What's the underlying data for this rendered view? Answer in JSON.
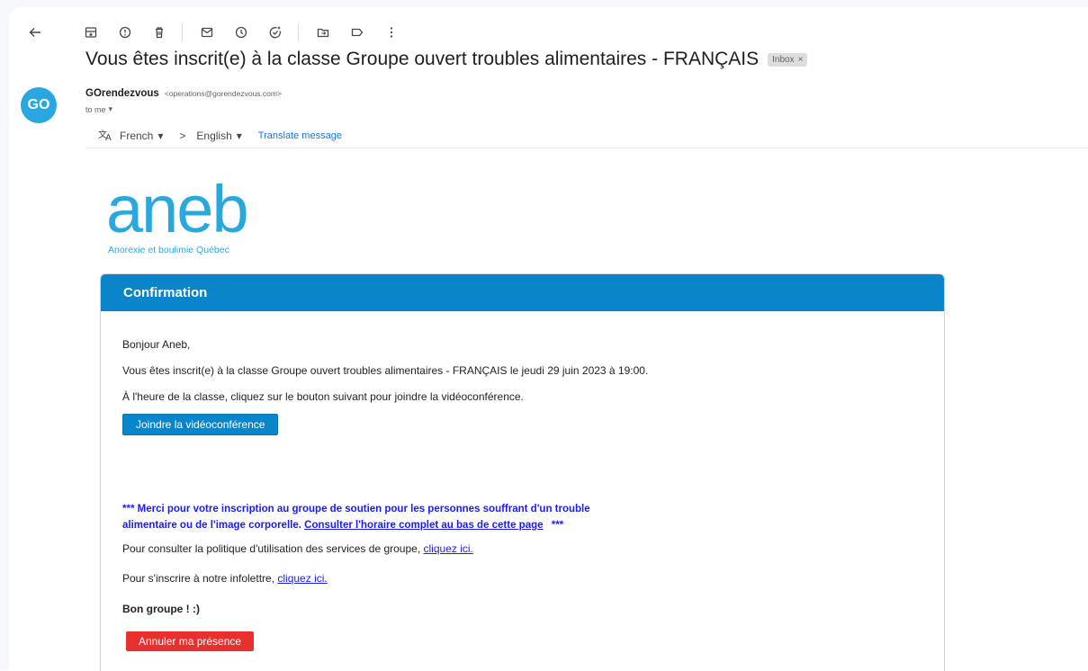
{
  "toolbar": {
    "icons": [
      "back-arrow-icon",
      "archive-icon",
      "report-spam-icon",
      "delete-icon",
      "mark-unread-icon",
      "snooze-icon",
      "add-task-icon",
      "move-to-icon",
      "label-icon",
      "more-icon"
    ]
  },
  "email": {
    "subject": "Vous êtes inscrit(e) à la classe Groupe ouvert troubles alimentaires - FRANÇAIS",
    "label_chip": "Inbox",
    "label_chip_close": "×",
    "avatar_text": "GO",
    "sender_name": "GOrendezvous",
    "sender_email": "<operations@gorendezvous.com>",
    "to_line": "to me",
    "to_caret": "▾"
  },
  "translate": {
    "icon": "translate-icon",
    "from_lang": "French",
    "to_lang": "English",
    "arrow": ">",
    "caret": "▾",
    "link": "Translate message"
  },
  "logo": {
    "word": "aneb",
    "tagline": "Anorexie et boulimie Québec"
  },
  "card": {
    "header": "Confirmation",
    "greeting": "Bonjour Aneb,",
    "registered": "Vous êtes inscrit(e) à la classe Groupe ouvert troubles alimentaires - FRANÇAIS le jeudi 29 juin 2023 à 19:00.",
    "instruction": "À l'heure de la classe, cliquez sur le bouton suivant pour joindre la vidéoconférence.",
    "join_button": "Joindre la vidéoconférence",
    "promo_text_1": "*** Merci pour votre inscription au groupe de soutien pour les personnes souffrant d'un trouble",
    "promo_text_2": "alimentaire ou de l'image corporelle.",
    "promo_link": "Consulter l'horaire complet au bas de cette page",
    "promo_end": "***",
    "policy_text": "Pour consulter la politique d'utilisation des services de groupe,",
    "policy_link": "cliquez ici.",
    "newsletter_text": "Pour s'inscrire à notre infolettre,",
    "newsletter_link": "cliquez ici.",
    "closing": "Bon groupe ! :)",
    "cancel_button": "Annuler ma présence"
  },
  "colors": {
    "accent_blue": "#0b85c9",
    "logo_blue": "#29a8e0",
    "link_blue": "#1a1aff",
    "cancel_red": "#e8302f"
  }
}
